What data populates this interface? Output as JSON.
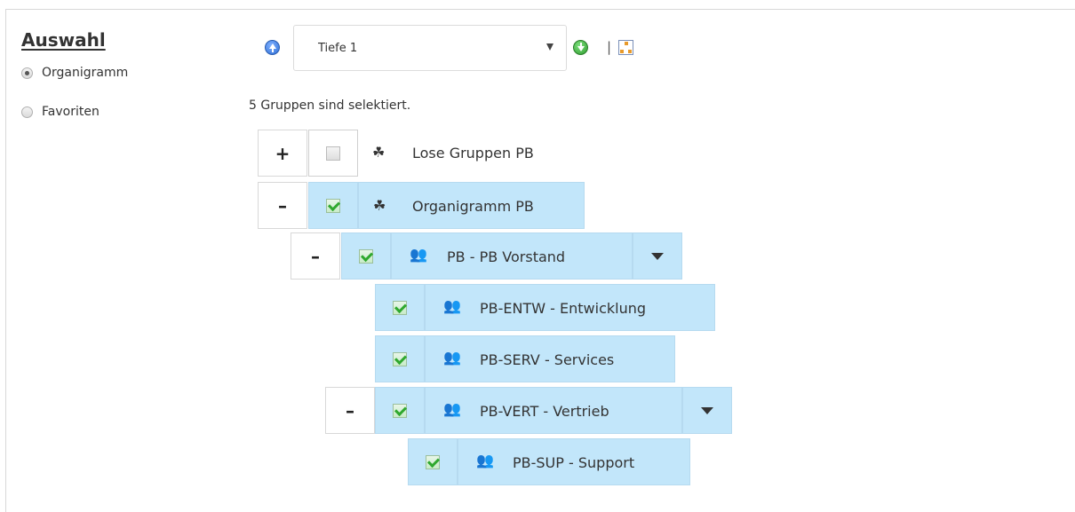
{
  "sidebar": {
    "title": "Auswahl",
    "options": [
      {
        "label": "Organigramm",
        "checked": true
      },
      {
        "label": "Favoriten",
        "checked": false
      }
    ]
  },
  "toolbar": {
    "up_icon": "circle-arrow-up-icon",
    "depth_select": {
      "value": "Tiefe 1"
    },
    "go_icon": "circle-arrow-down-icon",
    "separator": "|",
    "chart_icon": "org-chart-icon"
  },
  "status": "5 Gruppen sind selektiert.",
  "tree": [
    {
      "label": "Lose Gruppen PB",
      "toggle": "+",
      "checked": false,
      "icon": "group-hierarchy-icon"
    },
    {
      "label": "Organigramm PB",
      "toggle": "–",
      "checked": true,
      "icon": "group-hierarchy-icon"
    },
    {
      "label": "PB - PB Vorstand",
      "toggle": "–",
      "checked": true,
      "icon": "users-icon",
      "has_dropdown": true
    },
    {
      "label": "PB-ENTW - Entwicklung",
      "checked": true,
      "icon": "users-icon"
    },
    {
      "label": "PB-SERV - Services",
      "checked": true,
      "icon": "users-icon"
    },
    {
      "label": "PB-VERT - Vertrieb",
      "toggle": "–",
      "checked": true,
      "icon": "users-icon",
      "has_dropdown": true
    },
    {
      "label": "PB-SUP - Support",
      "checked": true,
      "icon": "users-icon"
    }
  ]
}
